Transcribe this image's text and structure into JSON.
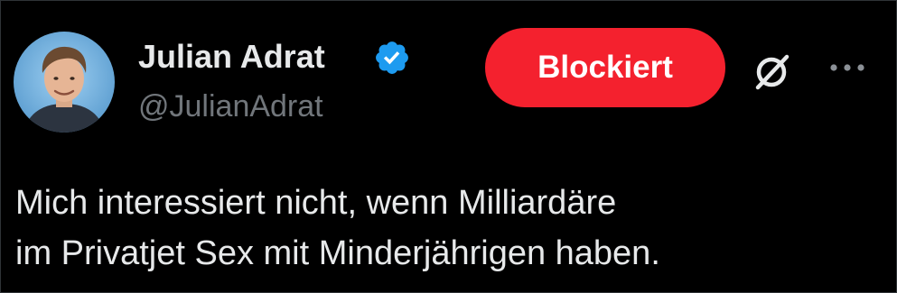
{
  "author": {
    "display_name": "Julian Adrat",
    "handle": "@JulianAdrat",
    "verified": true
  },
  "actions": {
    "block_label": "Blockiert"
  },
  "icons": {
    "verified": "verified-badge-icon",
    "grok": "grok-icon",
    "more": "more-icon"
  },
  "tweet": {
    "lines": [
      "Mich interessiert nicht, wenn Milliardäre",
      "im Privatjet Sex mit Minderjährigen haben."
    ]
  },
  "colors": {
    "background": "#000000",
    "text": "#e7e9ea",
    "muted": "#71767b",
    "block_button": "#f4212e",
    "verified": "#1d9bf0"
  }
}
